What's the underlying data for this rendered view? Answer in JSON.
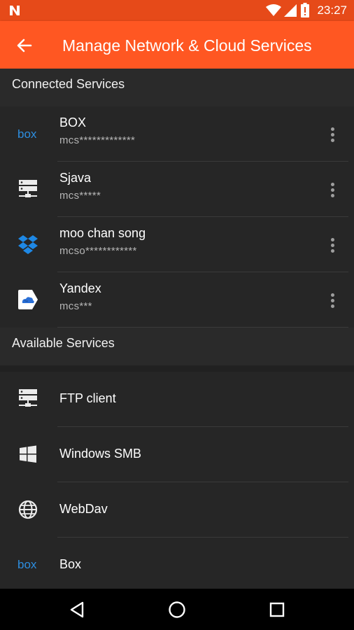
{
  "status_bar": {
    "time": "23:27"
  },
  "app_bar": {
    "title": "Manage Network & Cloud Services"
  },
  "connected": {
    "header": "Connected Services",
    "items": [
      {
        "name": "BOX",
        "account": "mcs*************",
        "icon": "box-icon"
      },
      {
        "name": "Sjava",
        "account": "mcs*****",
        "icon": "server-icon"
      },
      {
        "name": "moo chan song",
        "account": "mcso************",
        "icon": "dropbox-icon"
      },
      {
        "name": "Yandex",
        "account": "mcs***",
        "icon": "yandex-disk-icon"
      }
    ]
  },
  "available": {
    "header": "Available Services",
    "items": [
      {
        "name": "FTP client",
        "icon": "server-icon"
      },
      {
        "name": "Windows SMB",
        "icon": "windows-icon"
      },
      {
        "name": "WebDav",
        "icon": "globe-icon"
      },
      {
        "name": "Box",
        "icon": "box-icon"
      }
    ]
  },
  "colors": {
    "app_bar": "#ff5722",
    "status_bar": "#e64a19",
    "background": "#212121",
    "box_blue": "#2d8ee0",
    "dropbox_blue": "#1e88e5"
  }
}
